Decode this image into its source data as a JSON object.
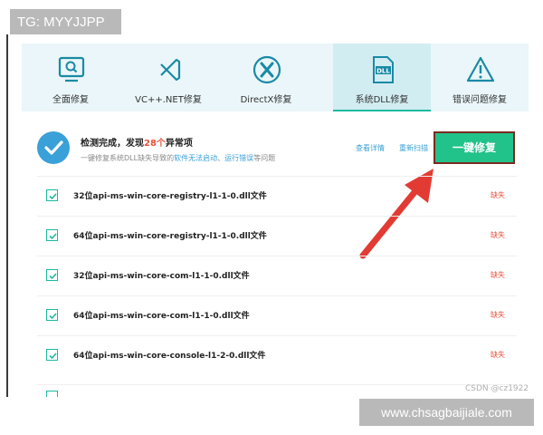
{
  "watermarks": {
    "tg": "TG: MYYJJPP",
    "domain": "www.chsagbaijiale.com",
    "csdn": "CSDN @cz1922"
  },
  "tabs": [
    {
      "label": "全面修复",
      "icon": "monitor-search-icon"
    },
    {
      "label": "VC++.NET修复",
      "icon": "visual-studio-icon"
    },
    {
      "label": "DirectX修复",
      "icon": "directx-icon"
    },
    {
      "label": "系统DLL修复",
      "icon": "dll-file-icon",
      "active": true
    },
    {
      "label": "错误问题修复",
      "icon": "warning-icon"
    }
  ],
  "status": {
    "title_prefix": "检测完成，发现",
    "count": "28个",
    "title_suffix": "异常项",
    "sub_prefix": "一键修复系统DLL缺失导致的",
    "sub_link1": "软件无法启动",
    "sub_sep": "、",
    "sub_link2": "运行错误",
    "sub_suffix": "等问题",
    "view_details": "查看详情",
    "rescan": "重新扫描",
    "repair_button": "一键修复"
  },
  "dll_rows": [
    {
      "name": "32位api-ms-win-core-registry-l1-1-0.dll文件",
      "state": "缺失",
      "checked": true
    },
    {
      "name": "64位api-ms-win-core-registry-l1-1-0.dll文件",
      "state": "缺失",
      "checked": true
    },
    {
      "name": "32位api-ms-win-core-com-l1-1-0.dll文件",
      "state": "缺失",
      "checked": true
    },
    {
      "name": "64位api-ms-win-core-com-l1-1-0.dll文件",
      "state": "缺失",
      "checked": true
    },
    {
      "name": "64位api-ms-win-core-console-l1-2-0.dll文件",
      "state": "缺失",
      "checked": true
    }
  ],
  "colors": {
    "accent": "#1db9a0",
    "button": "#22c28b",
    "alert": "#e8533c",
    "link": "#3aa0d8",
    "arrow": "#e23b33"
  }
}
